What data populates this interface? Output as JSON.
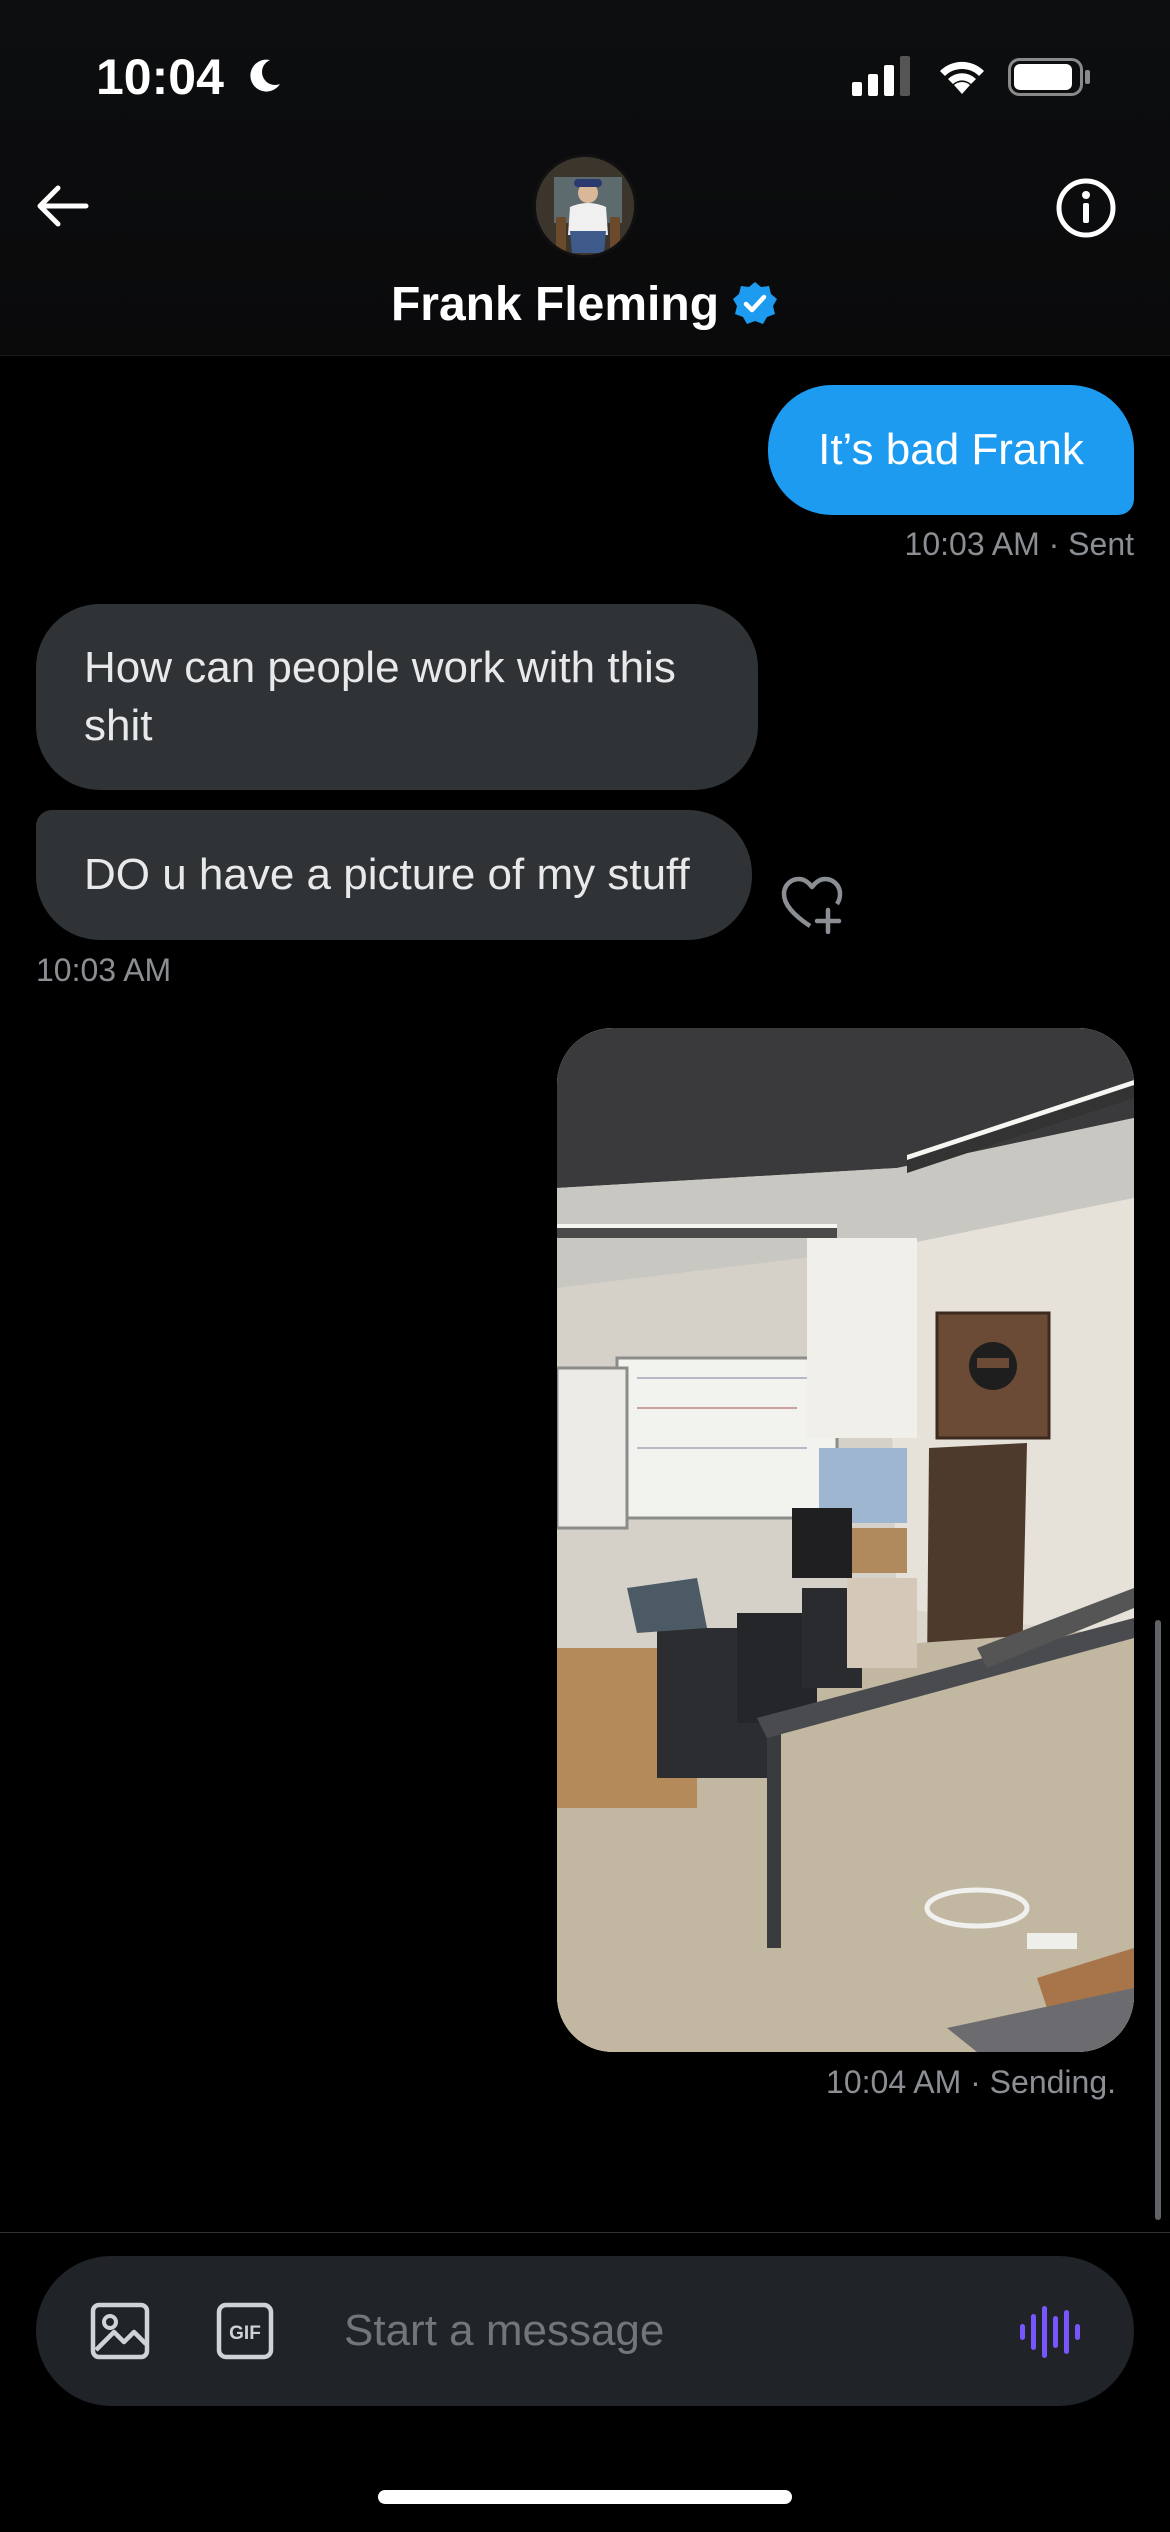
{
  "status_bar": {
    "time": "10:04"
  },
  "header": {
    "contact_name": "Frank Fleming",
    "verified": true
  },
  "messages": [
    {
      "direction": "sent",
      "text": "It’s bad Frank",
      "meta": "10:03 AM · Sent"
    },
    {
      "direction": "received",
      "text": "How can people work with this shit"
    },
    {
      "direction": "received",
      "text": "DO u have a picture of my stuff",
      "meta": "10:03 AM"
    },
    {
      "direction": "sent",
      "type": "image",
      "meta": "10:04 AM · Sending."
    }
  ],
  "composer": {
    "placeholder": "Start a message",
    "gif_label": "GIF"
  },
  "colors": {
    "accent": "#1d9bf0",
    "received_bubble": "#2f3336",
    "voice_icon": "#7856ff"
  }
}
